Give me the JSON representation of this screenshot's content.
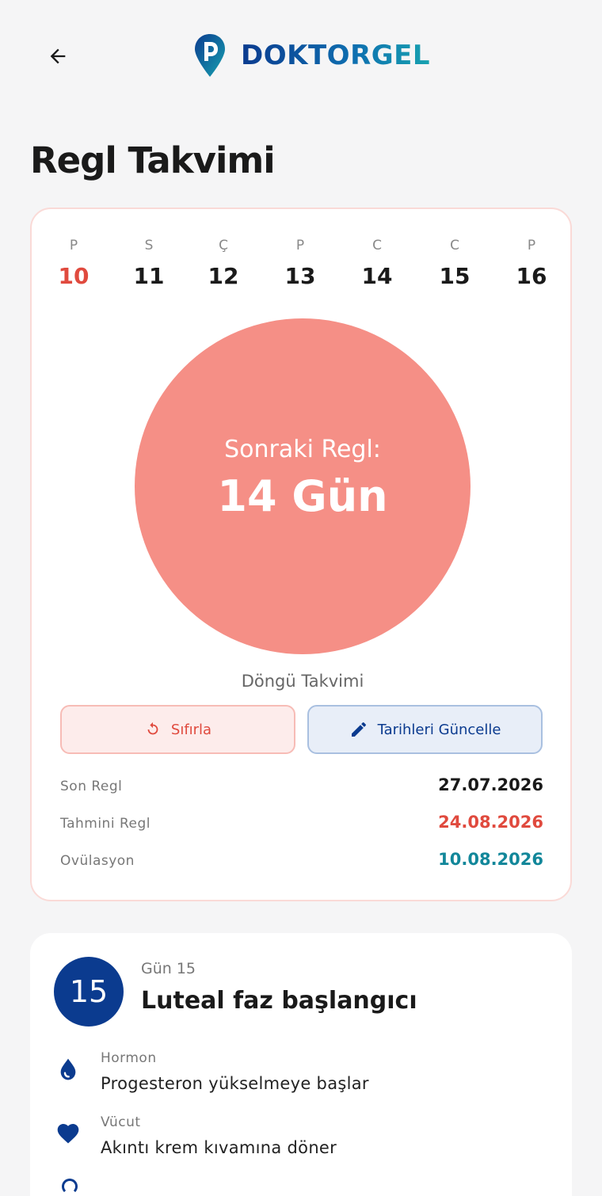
{
  "header": {
    "logo_text": "DOKTORGEL",
    "back_icon": "arrow-left-icon"
  },
  "page_title": "Regl Takvimi",
  "week": [
    {
      "dow": "P",
      "num": "10",
      "today": true
    },
    {
      "dow": "S",
      "num": "11"
    },
    {
      "dow": "Ç",
      "num": "12"
    },
    {
      "dow": "P",
      "num": "13"
    },
    {
      "dow": "C",
      "num": "14"
    },
    {
      "dow": "C",
      "num": "15"
    },
    {
      "dow": "P",
      "num": "16"
    }
  ],
  "countdown": {
    "label": "Sonraki Regl:",
    "value": "14 Gün"
  },
  "cycle_label": "Döngü Takvimi",
  "buttons": {
    "reset": "Sıfırla",
    "update": "Tarihleri Güncelle"
  },
  "info": [
    {
      "label": "Son Regl",
      "value": "27.07.2026",
      "color": "#1a1a1a"
    },
    {
      "label": "Tahmini Regl",
      "value": "24.08.2026",
      "color": "#e04a3e"
    },
    {
      "label": "Ovülasyon",
      "value": "10.08.2026",
      "color": "#12879a"
    }
  ],
  "day_card": {
    "badge": "15",
    "subtitle": "Gün 15",
    "title": "Luteal faz başlangıcı",
    "details": [
      {
        "label": "Hormon",
        "value": "Progesteron yükselmeye başlar",
        "icon": "drop-icon"
      },
      {
        "label": "Vücut",
        "value": "Akıntı krem kıvamına döner",
        "icon": "heart-icon"
      }
    ]
  },
  "colors": {
    "accent": "#0b3b8f",
    "circle": "#f58f86",
    "danger": "#e04a3e",
    "teal": "#12879a"
  }
}
